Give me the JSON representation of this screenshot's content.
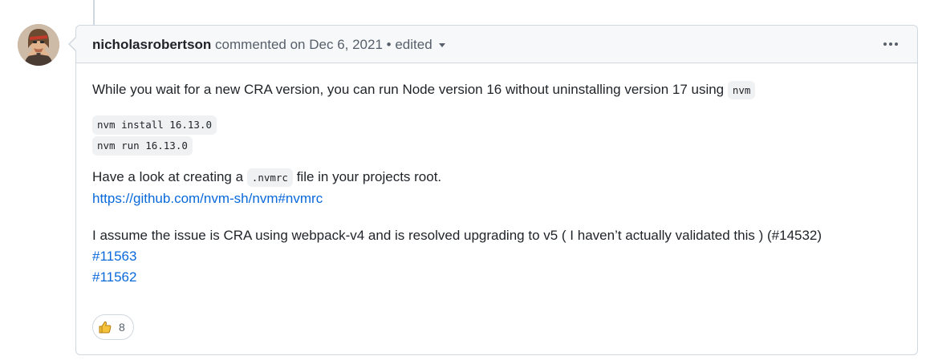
{
  "comment": {
    "author": "nicholasrobertson",
    "action": "commented on",
    "date": "Dec 6, 2021",
    "separator": "•",
    "edited_label": "edited",
    "body": {
      "p1_text": "While you wait for a new CRA version, you can run Node version 16 without uninstalling version 17 using",
      "p1_code": "nvm",
      "code_line_1": "nvm install 16.13.0",
      "code_line_2": "nvm run 16.13.0",
      "p2_text_before": "Have a look at creating a",
      "p2_code": ".nvmrc",
      "p2_text_after": "file in your projects root.",
      "p2_link": "https://github.com/nvm-sh/nvm#nvmrc",
      "p3_text": "I assume the issue is CRA using webpack-v4 and is resolved upgrading to v5 ( I haven’t actually validated this ) (#14532)",
      "issue_link_1": "#11563",
      "issue_link_2": "#11562"
    },
    "reaction": {
      "icon": "thumbs-up-icon",
      "count": "8"
    }
  }
}
